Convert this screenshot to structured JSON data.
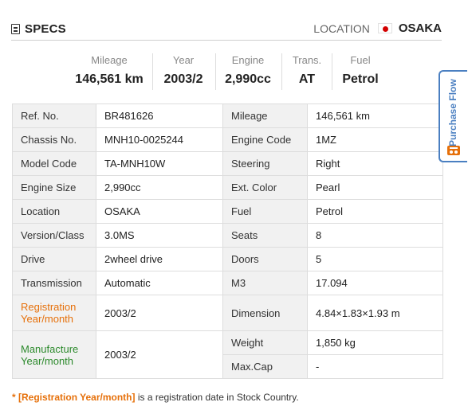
{
  "header": {
    "title": "SPECS",
    "location_label": "LOCATION",
    "location_value": "OSAKA",
    "flag": "japan-flag"
  },
  "summary": [
    {
      "label": "Mileage",
      "value": "146,561 km"
    },
    {
      "label": "Year",
      "value": "2003/2"
    },
    {
      "label": "Engine",
      "value": "2,990cc"
    },
    {
      "label": "Trans.",
      "value": "AT"
    },
    {
      "label": "Fuel",
      "value": "Petrol"
    }
  ],
  "specs": {
    "left": [
      {
        "label": "Ref. No.",
        "value": "BR481626"
      },
      {
        "label": "Chassis No.",
        "value": "MNH10-0025244"
      },
      {
        "label": "Model Code",
        "value": "TA-MNH10W"
      },
      {
        "label": "Engine Size",
        "value": "2,990cc"
      },
      {
        "label": "Location",
        "value": "OSAKA"
      },
      {
        "label": "Version/Class",
        "value": "3.0MS"
      },
      {
        "label": "Drive",
        "value": "2wheel drive"
      },
      {
        "label": "Transmission",
        "value": "Automatic"
      },
      {
        "label": "Registration Year/month",
        "value": "2003/2"
      },
      {
        "label": "Manufacture Year/month",
        "value": "2003/2"
      }
    ],
    "right": [
      {
        "label": "Mileage",
        "value": "146,561 km"
      },
      {
        "label": "Engine Code",
        "value": "1MZ"
      },
      {
        "label": "Steering",
        "value": "Right"
      },
      {
        "label": "Ext. Color",
        "value": "Pearl"
      },
      {
        "label": "Fuel",
        "value": "Petrol"
      },
      {
        "label": "Seats",
        "value": "8"
      },
      {
        "label": "Doors",
        "value": "5"
      },
      {
        "label": "M3",
        "value": "17.094"
      },
      {
        "label": "Dimension",
        "value": "4.84×1.83×1.93 m"
      },
      {
        "label": "Weight",
        "value": "1,850 kg"
      },
      {
        "label": "Max.Cap",
        "value": "-"
      }
    ]
  },
  "footnote": {
    "star": "*",
    "highlight": "[Registration Year/month]",
    "text": " is a registration date in Stock Country."
  },
  "purchase_tab": {
    "label": "Purchase Flow",
    "icon": "cart-icon"
  },
  "colors": {
    "accent_orange": "#e6700a",
    "accent_green": "#2d8a2d",
    "tab_blue": "#4a7fc1"
  }
}
